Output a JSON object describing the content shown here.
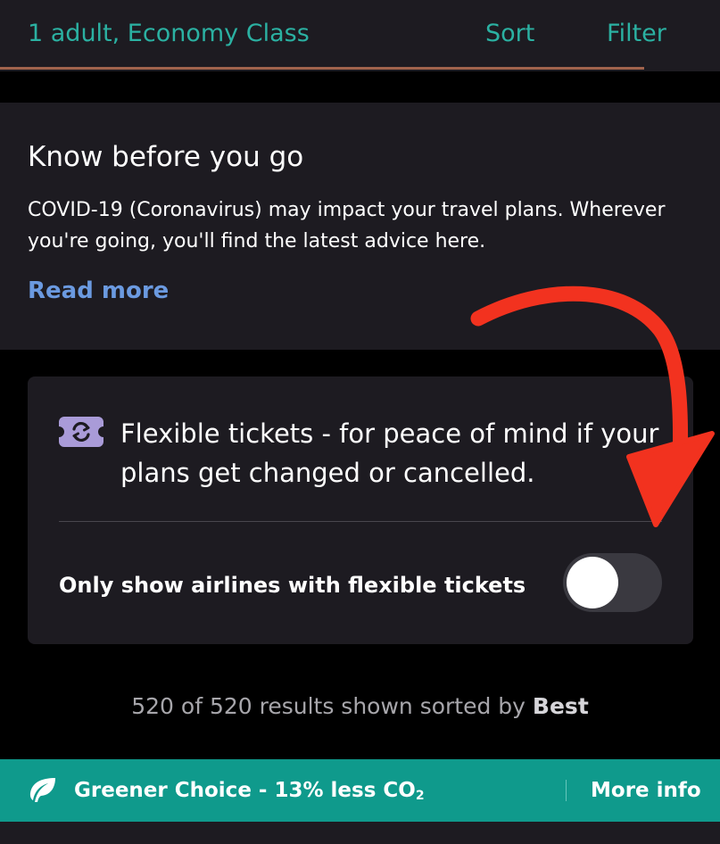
{
  "header": {
    "title": "1 adult, Economy Class",
    "sort_label": "Sort",
    "filter_label": "Filter",
    "progress": 0.895
  },
  "info_card": {
    "title": "Know before you go",
    "body": "COVID-19 (Coronavirus) may impact your travel plans. Wherever you're going, you'll find the latest advice here.",
    "link": "Read more"
  },
  "flex_card": {
    "icon": "flexible-ticket-icon",
    "text": "Flexible tickets - for peace of mind if your plans get changed or cancelled.",
    "toggle_label": "Only show airlines with flexible tickets",
    "toggle_on": false
  },
  "results": {
    "summary": "520 of 520 results shown sorted by ",
    "sort_value": "Best"
  },
  "green_banner": {
    "icon": "leaf-icon",
    "text_main": "Greener Choice - 13% less CO",
    "text_sub": "2",
    "more_info": "More info"
  },
  "colors": {
    "accent_teal": "#2bb1a2",
    "link_blue": "#6b9ae0",
    "banner_green": "#0f9a8c",
    "annotation_red": "#f2321f"
  }
}
